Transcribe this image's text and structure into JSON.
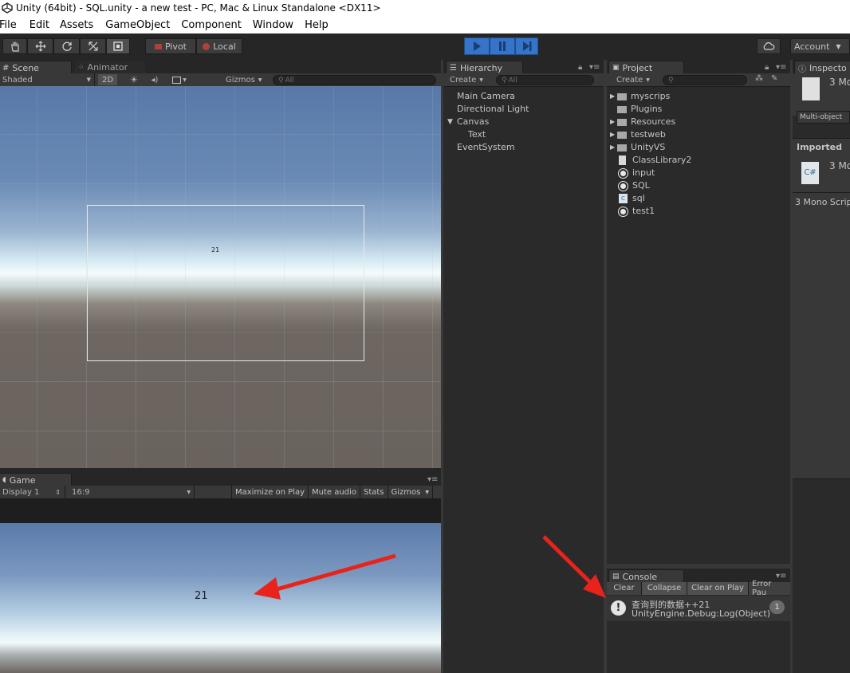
{
  "window": {
    "title": "Unity (64bit) - SQL.unity - a new test - PC, Mac & Linux Standalone <DX11>"
  },
  "menu": [
    "File",
    "Edit",
    "Assets",
    "GameObject",
    "Component",
    "Window",
    "Help"
  ],
  "toolbar": {
    "pivot_label": "Pivot",
    "local_label": "Local",
    "account_label": "Account"
  },
  "scene": {
    "tab_label": "Scene",
    "animator_tab_label": "Animator",
    "shading_mode": "Shaded",
    "mode_2d": "2D",
    "gizmos_label": "Gizmos",
    "search_placeholder": "All",
    "canvas_text": "21"
  },
  "game": {
    "tab_label": "Game",
    "display": "Display 1",
    "aspect": "16:9",
    "maximize_label": "Maximize on Play",
    "mute_label": "Mute audio",
    "stats_label": "Stats",
    "gizmos_label": "Gizmos",
    "text_value": "21"
  },
  "hierarchy": {
    "tab_label": "Hierarchy",
    "create_label": "Create",
    "search_placeholder": "All",
    "items": [
      {
        "label": "Main Camera",
        "indent": 0
      },
      {
        "label": "Directional Light",
        "indent": 0
      },
      {
        "label": "Canvas",
        "indent": 0,
        "expanded": true
      },
      {
        "label": "Text",
        "indent": 1
      },
      {
        "label": "EventSystem",
        "indent": 0
      }
    ]
  },
  "project": {
    "tab_label": "Project",
    "create_label": "Create",
    "items": [
      {
        "label": "myscrips",
        "icon": "folder"
      },
      {
        "label": "Plugins",
        "icon": "folder"
      },
      {
        "label": "Resources",
        "icon": "folder"
      },
      {
        "label": "testweb",
        "icon": "folder"
      },
      {
        "label": "UnityVS",
        "icon": "folder"
      },
      {
        "label": "ClassLibrary2",
        "icon": "file"
      },
      {
        "label": "input",
        "icon": "unity-script"
      },
      {
        "label": "SQL",
        "icon": "unity-script"
      },
      {
        "label": "sql",
        "icon": "csharp"
      },
      {
        "label": "test1",
        "icon": "unity-script"
      }
    ]
  },
  "inspector": {
    "tab_label": "Inspecto",
    "count_label_1": "3 Mo",
    "multi_object_label": "Multi-object",
    "imported_label": "Imported",
    "count_label_2": "3 Mo",
    "csharp_icon_text": "C#",
    "mono_scripts_label": "3 Mono Scrip"
  },
  "console": {
    "tab_label": "Console",
    "clear_label": "Clear",
    "collapse_label": "Collapse",
    "clear_on_play_label": "Clear on Play",
    "error_pause_label": "Error Pau",
    "log_line1": "查询到的数据++21",
    "log_line2": "UnityEngine.Debug:Log(Object)",
    "log_count": "1"
  },
  "colors": {
    "annotation_arrow": "#e8231b",
    "play_button": "#3574c8"
  }
}
